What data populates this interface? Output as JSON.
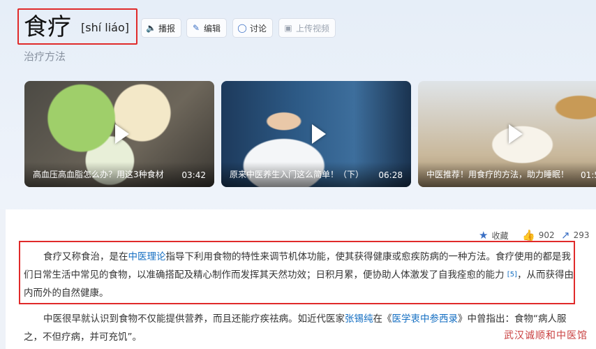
{
  "header": {
    "title": "食疗",
    "pinyin": "[shí liáo]",
    "subtitle": "治疗方法",
    "actions": [
      {
        "label": "播报",
        "icon": "speaker-icon"
      },
      {
        "label": "编辑",
        "icon": "pencil-icon"
      },
      {
        "label": "讨论",
        "icon": "chat-icon"
      },
      {
        "label": "上传视频",
        "icon": "video-upload-icon"
      }
    ]
  },
  "videos": [
    {
      "title": "高血压高血脂怎么办？用这3种食材",
      "duration": "03:42"
    },
    {
      "title": "原来中医养生入门这么简单！（下）",
      "duration": "06:28"
    },
    {
      "title": "中医推荐！用食疗的方法，助力睡眠！",
      "duration": "01:5"
    }
  ],
  "stats": {
    "collect_label": "收藏",
    "likes": "902",
    "shares": "293"
  },
  "paragraphs": {
    "p1_a": "食疗又称食治，是在",
    "p1_link": "中医理论",
    "p1_b": "指导下利用食物的特性来调节机体功能，使其获得健康或愈疾防病的一种方法。食疗使用的都是我们日常生活中常见的食物，以准确搭配及精心制作而发挥其天然功效；日积月累，便协助人体激发了自我痊愈的能力",
    "p1_ref": "[5]",
    "p1_c": "，从而获得由内而外的自然健康。",
    "p2_a": "中医很早就认识到食物不仅能提供营养，而且还能疗疾祛病。如近代医家",
    "p2_link1": "张锡纯",
    "p2_b": "在《",
    "p2_link2": "医学衷中参西录",
    "p2_c": "》中曾指出：食物“病人服之，不但疗病，并可充饥”。"
  },
  "watermark": "武汉诚顺和中医馆",
  "colors": {
    "accent": "#136ec2",
    "highlight_border": "#e02a2a"
  }
}
